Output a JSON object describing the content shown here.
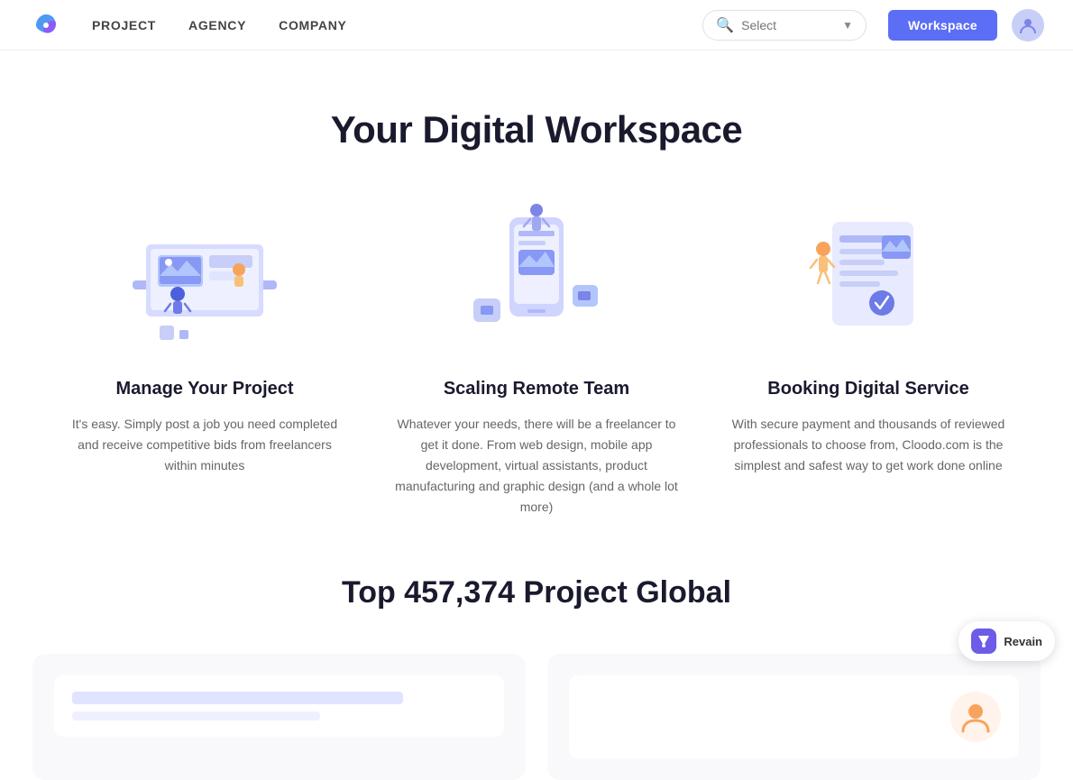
{
  "nav": {
    "logo_label": "Cloodo",
    "links": [
      {
        "id": "project",
        "label": "PROJECT"
      },
      {
        "id": "agency",
        "label": "AGENCY"
      },
      {
        "id": "company",
        "label": "COMPANY"
      }
    ],
    "search_placeholder": "Select",
    "workspace_btn": "Workspace",
    "avatar_alt": "User avatar"
  },
  "hero": {
    "title": "Your Digital Workspace"
  },
  "features": [
    {
      "id": "manage",
      "title": "Manage Your Project",
      "desc": "It's easy. Simply post a job you need completed and receive competitive bids from freelancers within minutes",
      "illustration": "laptop"
    },
    {
      "id": "scaling",
      "title": "Scaling Remote Team",
      "desc": "Whatever your needs, there will be a freelancer to get it done. From web design, mobile app development, virtual assistants, product manufacturing and graphic design (and a whole lot more)",
      "illustration": "phone"
    },
    {
      "id": "booking",
      "title": "Booking Digital Service",
      "desc": "With secure payment and thousands of reviewed professionals to choose from, Cloodo.com is the simplest and safest way to get work done online",
      "illustration": "document"
    }
  ],
  "stats": {
    "title": "Top 457,374 Project Global"
  },
  "bottom_cards": [
    {
      "id": "card-left",
      "inner_label": ""
    },
    {
      "id": "card-right",
      "inner_label": ""
    }
  ],
  "revain": {
    "label": "Revain"
  }
}
